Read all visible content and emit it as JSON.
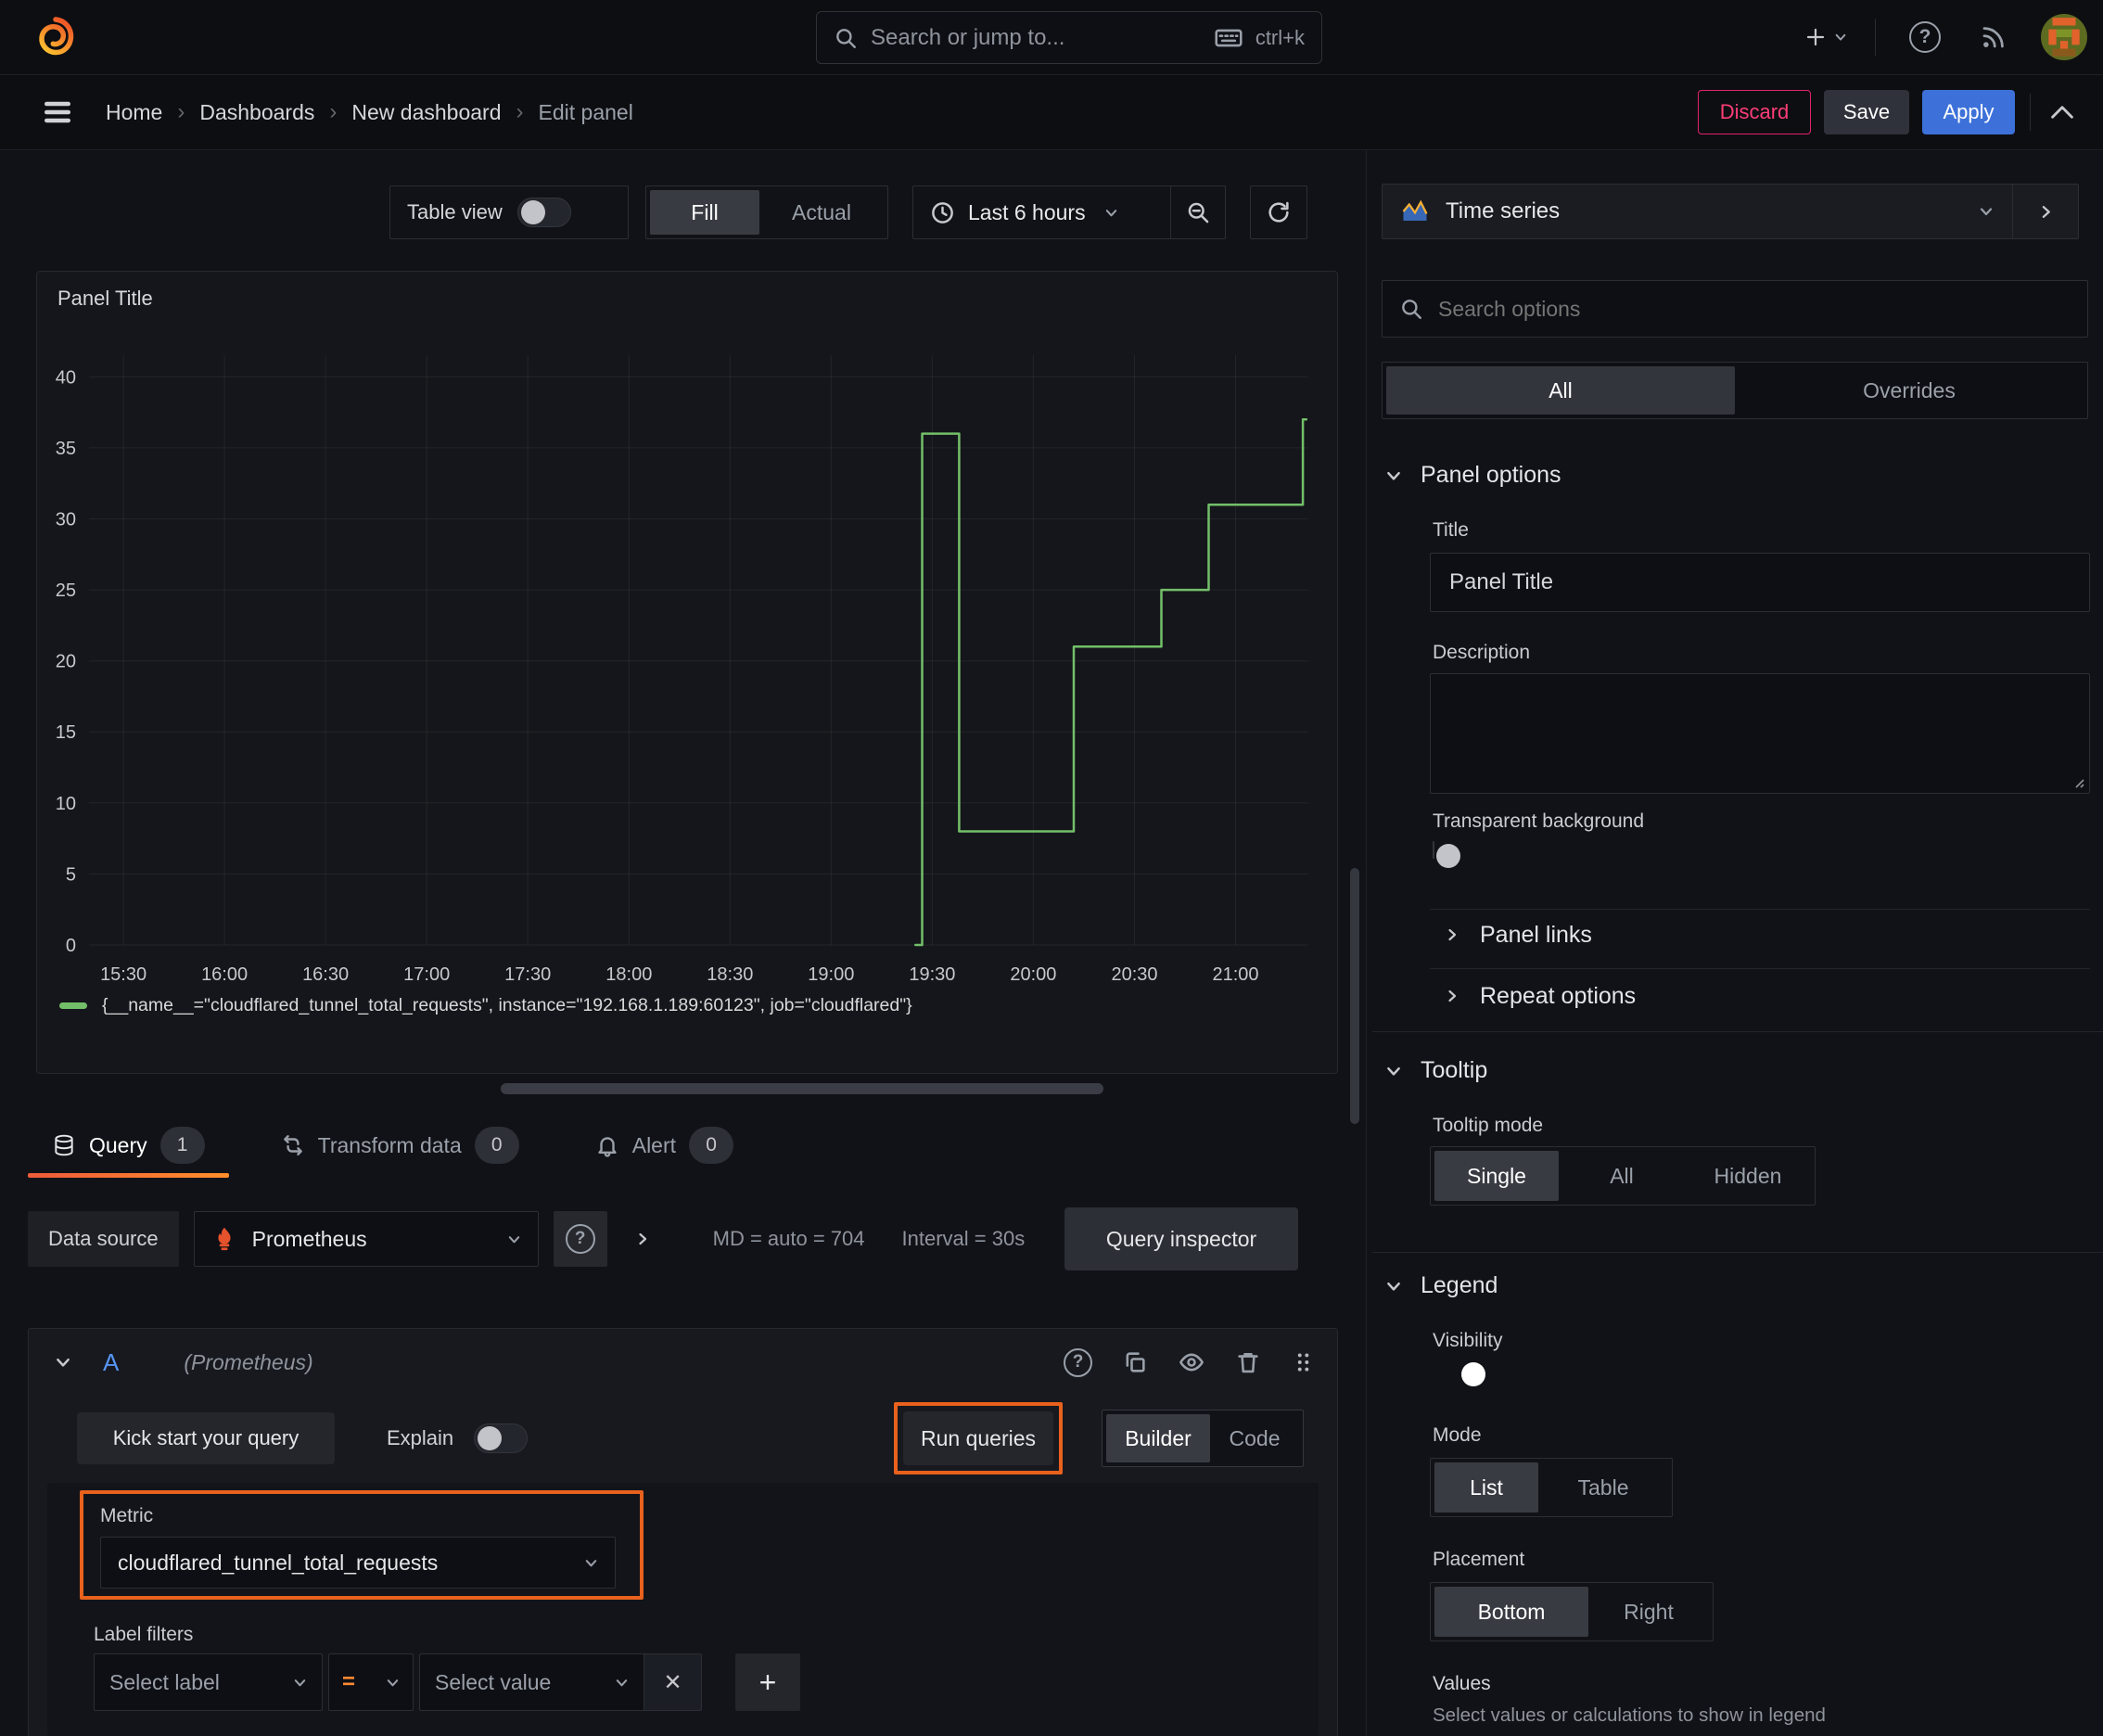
{
  "topbar": {
    "search_placeholder": "Search or jump to...",
    "search_shortcut": "ctrl+k"
  },
  "icons": {
    "help_glyph": "?",
    "close_glyph": "✕",
    "add_glyph": "+",
    "breadcrumb_sep": "›"
  },
  "breadcrumb": {
    "items": [
      "Home",
      "Dashboards",
      "New dashboard",
      "Edit panel"
    ]
  },
  "actions": {
    "discard": "Discard",
    "save": "Save",
    "apply": "Apply"
  },
  "panel_toolbar": {
    "table_view": "Table view",
    "fill": "Fill",
    "actual": "Actual",
    "time_range": "Last 6 hours"
  },
  "viz_picker": {
    "label": "Time series"
  },
  "panel": {
    "title": "Panel Title",
    "legend_label": "{__name__=\"cloudflared_tunnel_total_requests\", instance=\"192.168.1.189:60123\", job=\"cloudflared\"}"
  },
  "chart_data": {
    "type": "line",
    "title": "Panel Title",
    "x_ticks": [
      "15:30",
      "16:00",
      "16:30",
      "17:00",
      "17:30",
      "18:00",
      "18:30",
      "19:00",
      "19:30",
      "20:00",
      "20:30",
      "21:00"
    ],
    "x_ticks_hours": [
      15.5,
      16,
      16.5,
      17,
      17.5,
      18,
      18.5,
      19,
      19.5,
      20,
      20.5,
      21
    ],
    "y_ticks": [
      0,
      5,
      10,
      15,
      20,
      25,
      30,
      35,
      40
    ],
    "ylim": [
      0,
      41
    ],
    "xlim_hours": [
      15.33,
      21.36
    ],
    "grid": true,
    "legend_position": "bottom",
    "series": [
      {
        "name": "{__name__=\"cloudflared_tunnel_total_requests\", instance=\"192.168.1.189:60123\", job=\"cloudflared\"}",
        "color": "#73bf69",
        "step_points_time_value": [
          [
            19.417,
            0
          ],
          [
            19.45,
            0
          ],
          [
            19.45,
            36
          ],
          [
            19.633,
            36
          ],
          [
            19.633,
            8
          ],
          [
            20.2,
            8
          ],
          [
            20.2,
            21
          ],
          [
            20.633,
            21
          ],
          [
            20.633,
            25
          ],
          [
            20.867,
            25
          ],
          [
            20.867,
            31
          ],
          [
            21.333,
            31
          ],
          [
            21.333,
            37
          ],
          [
            21.35,
            37
          ]
        ]
      }
    ]
  },
  "query_tabs": {
    "tabs": [
      {
        "label": "Query",
        "badge": "1"
      },
      {
        "label": "Transform data",
        "badge": "0"
      },
      {
        "label": "Alert",
        "badge": "0"
      }
    ]
  },
  "datasource_row": {
    "label": "Data source",
    "value": "Prometheus",
    "max_data_points": "MD = auto = 704",
    "interval": "Interval = 30s",
    "inspector": "Query inspector"
  },
  "query_editor": {
    "ref_id": "A",
    "ds_hint": "(Prometheus)",
    "kick_start": "Kick start your query",
    "explain": "Explain",
    "run_queries": "Run queries",
    "builder": "Builder",
    "code": "Code",
    "metric": {
      "label": "Metric",
      "value": "cloudflared_tunnel_total_requests"
    },
    "label_filters": {
      "label": "Label filters",
      "select_label": "Select label",
      "operator": "=",
      "select_value": "Select value"
    }
  },
  "options_pane": {
    "search_placeholder": "Search options",
    "tabs": {
      "all": "All",
      "overrides": "Overrides"
    },
    "panel_options": {
      "heading": "Panel options",
      "title_label": "Title",
      "title_value": "Panel Title",
      "description_label": "Description",
      "transparent_label": "Transparent background",
      "panel_links": "Panel links",
      "repeat_options": "Repeat options"
    },
    "tooltip": {
      "heading": "Tooltip",
      "mode_label": "Tooltip mode",
      "modes": [
        "Single",
        "All",
        "Hidden"
      ],
      "selected_mode": "Single"
    },
    "legend": {
      "heading": "Legend",
      "visibility_label": "Visibility",
      "mode_label": "Mode",
      "modes": [
        "List",
        "Table"
      ],
      "selected_mode": "List",
      "placement_label": "Placement",
      "placements": [
        "Bottom",
        "Right"
      ],
      "selected_placement": "Bottom",
      "values_label": "Values",
      "values_help": "Select values or calculations to show in legend"
    }
  },
  "colors": {
    "accent_blue": "#3d71d9",
    "orange_highlight": "#e8611d",
    "series_green": "#73bf69",
    "discard_pink": "#e0226e",
    "prometheus_orange": "#e6522c",
    "ref_id_blue": "#5794f2"
  }
}
